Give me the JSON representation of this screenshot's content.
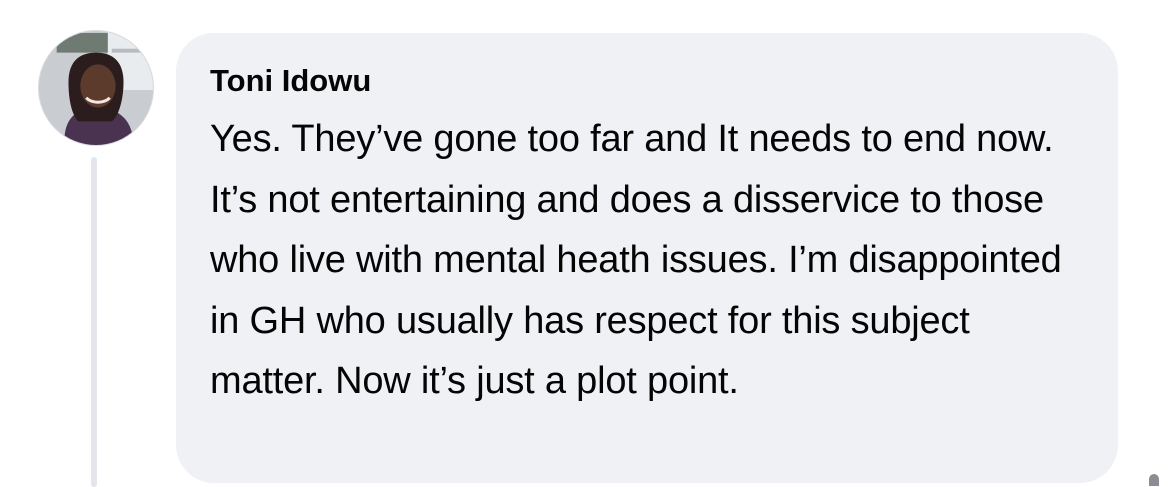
{
  "comment": {
    "author": "Toni Idowu",
    "text": "Yes. They’ve gone too far and It needs to end now. It’s not entertaining and does a disservice to those who live with mental heath issues. I’m disappointed in GH who usually has respect for this subject matter. Now it’s just a plot point."
  },
  "colors": {
    "bubble_background": "#eff1f5",
    "text": "#050505",
    "thread_line": "#e4e6eb"
  },
  "icons": {
    "avatar": "profile-photo",
    "more": "more-dots-icon"
  }
}
